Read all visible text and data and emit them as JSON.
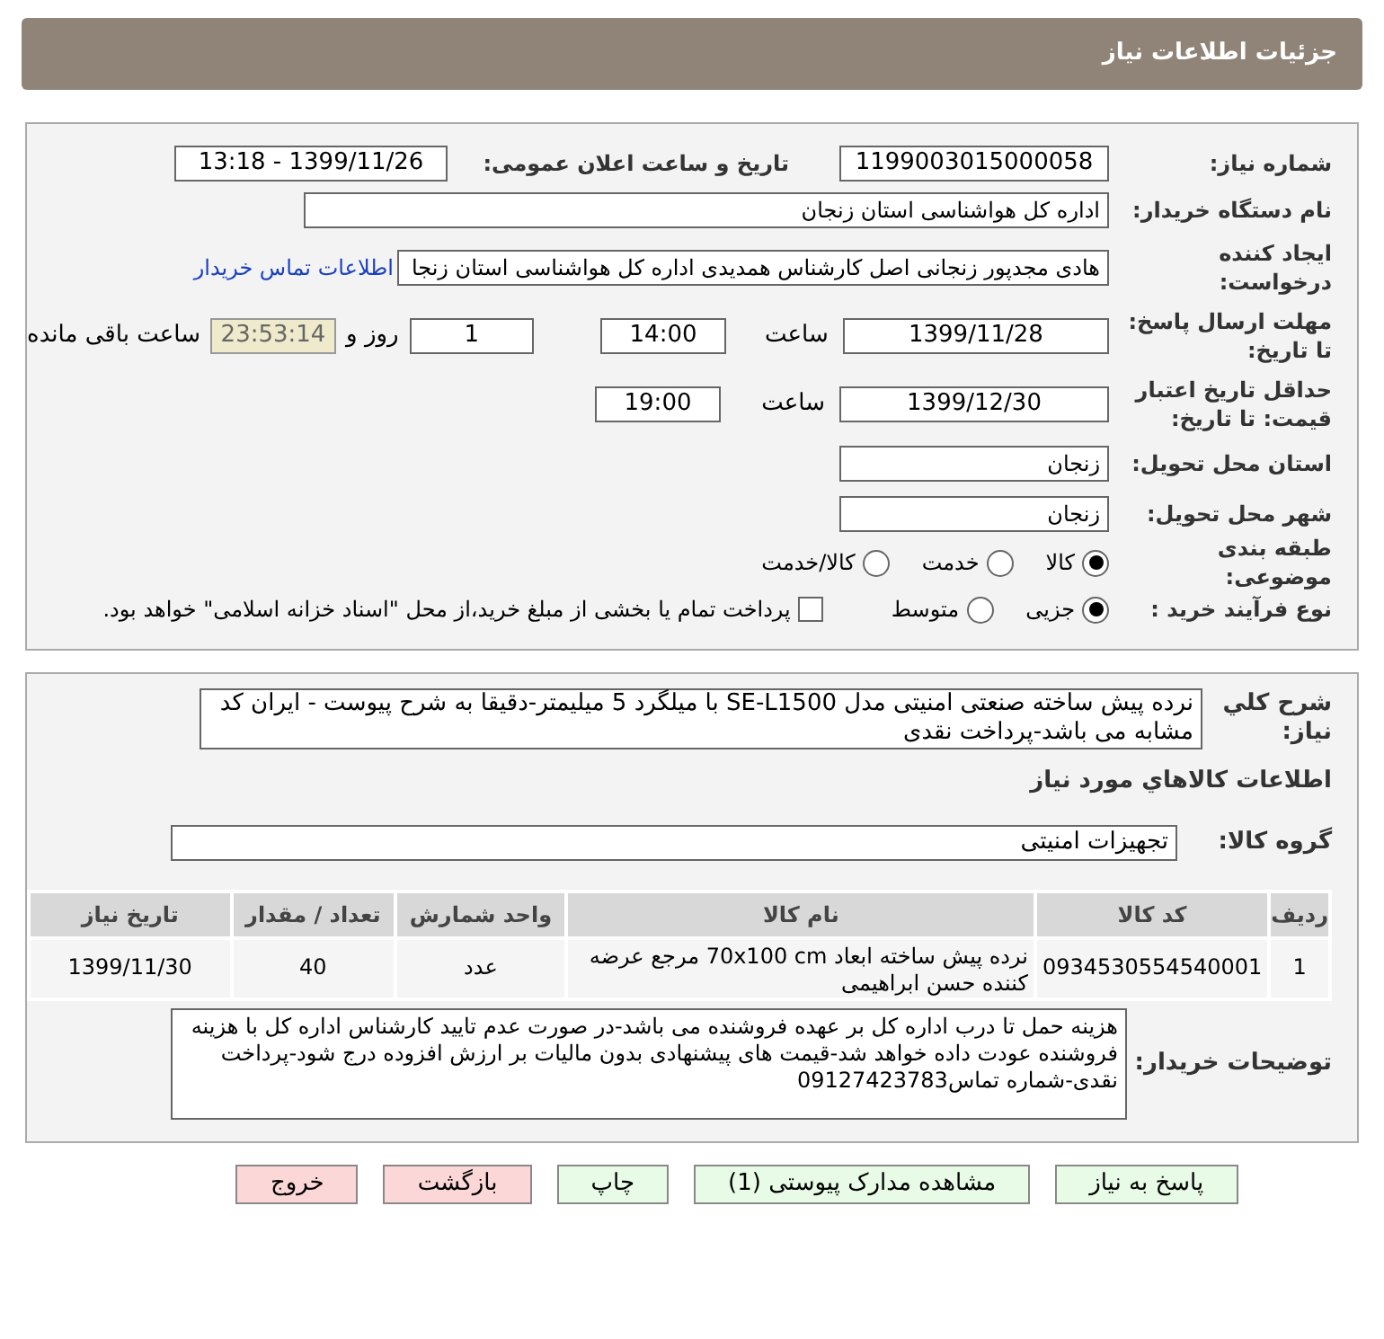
{
  "header": {
    "title": "جزئیات اطلاعات نیاز"
  },
  "details": {
    "need_number": {
      "label": "شماره نیاز:",
      "value": "1199003015000058"
    },
    "announce": {
      "label": "تاریخ و ساعت اعلان عمومی:",
      "value": "1399/11/26 - 13:18"
    },
    "buyer_org": {
      "label": "نام دستگاه خریدار:",
      "value": "اداره کل هواشناسی استان زنجان"
    },
    "creator": {
      "label": "ایجاد کننده درخواست:",
      "value": "هادی مجدپور زنجانی اصل کارشناس همدیدی اداره کل هواشناسی استان زنجا",
      "link": "اطلاعات تماس خریدار"
    },
    "deadline": {
      "label": "مهلت ارسال پاسخ: تا تاریخ:",
      "date": "1399/11/28",
      "time_label": "ساعت",
      "time": "14:00",
      "days": "1",
      "days_label": "روز و",
      "remaining": "23:53:14",
      "remaining_label": "ساعت باقی مانده"
    },
    "validity": {
      "label": "حداقل تاریخ اعتبار قیمت: تا تاریخ:",
      "date": "1399/12/30",
      "time_label": "ساعت",
      "time": "19:00"
    },
    "province": {
      "label": "استان محل تحویل:",
      "value": "زنجان"
    },
    "city": {
      "label": "شهر محل تحویل:",
      "value": "زنجان"
    },
    "category": {
      "label": "طبقه بندی موضوعی:",
      "options": [
        {
          "label": "کالا",
          "selected": true
        },
        {
          "label": "خدمت",
          "selected": false
        },
        {
          "label": "کالا/خدمت",
          "selected": false
        }
      ]
    },
    "process": {
      "label": "نوع فرآیند خرید :",
      "options": [
        {
          "label": "جزیی",
          "selected": true
        },
        {
          "label": "متوسط",
          "selected": false
        }
      ],
      "treasury": {
        "label": "پرداخت تمام یا بخشی از مبلغ خرید،از محل \"اسناد خزانه اسلامی\" خواهد بود.",
        "checked": false
      }
    }
  },
  "need": {
    "description": {
      "label": "شرح کلي نياز:",
      "value": "نرده پیش ساخته صنعتی امنیتی مدل SE-L1500 با میلگرد 5 میلیمتر-دقیقا به شرح پیوست - ایران کد مشابه می باشد-پرداخت نقدی"
    },
    "section_title": "اطلاعات کالاهاي مورد نياز",
    "group": {
      "label": "گروه کالا:",
      "value": "تجهیزات امنیتی"
    },
    "table": {
      "columns": [
        "ردیف",
        "کد کالا",
        "نام کالا",
        "واحد شمارش",
        "تعداد / مقدار",
        "تاریخ نیاز"
      ],
      "rows": [
        [
          "1",
          "0934530554540001",
          "نرده پیش ساخته ابعاد 70x100 cm مرجع عرضه کننده حسن ابراهیمی",
          "عدد",
          "40",
          "1399/11/30"
        ]
      ]
    },
    "notes": {
      "label": "توضیحات خریدار:",
      "value": "هزینه حمل تا درب اداره کل بر عهده فروشنده می باشد-در صورت عدم تایید کارشناس اداره کل با هزینه فروشنده عودت داده خواهد شد-قیمت های پیشنهادی بدون مالیات بر ارزش افزوده درج شود-پرداخت نقدی-شماره تماس09127423783"
    }
  },
  "buttons": [
    {
      "label": "پاسخ به نیاز",
      "kind": "normal"
    },
    {
      "label": "مشاهده مدارک پیوستی (1)",
      "kind": "normal"
    },
    {
      "label": "چاپ",
      "kind": "normal"
    },
    {
      "label": "بازگشت",
      "kind": "danger"
    },
    {
      "label": "خروج",
      "kind": "danger"
    }
  ]
}
